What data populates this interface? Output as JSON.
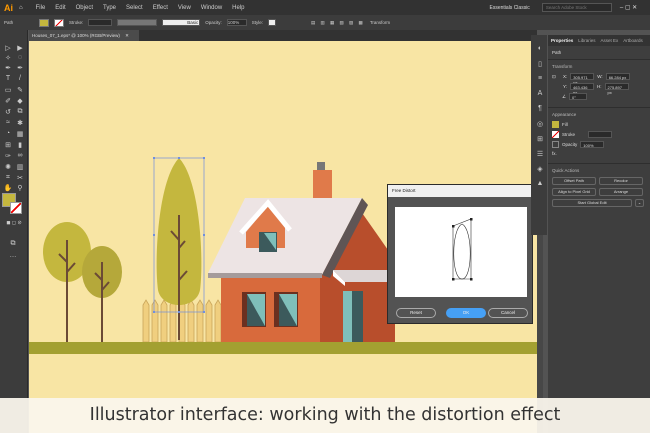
{
  "app": {
    "logo": "Ai",
    "menu": [
      "File",
      "Edit",
      "Object",
      "Type",
      "Select",
      "Effect",
      "View",
      "Window",
      "Help"
    ],
    "workspace": "Essentials Classic",
    "search_placeholder": "Search Adobe Stock"
  },
  "control_bar": {
    "selection": "Path",
    "stroke_label": "Stroke:",
    "brush": "Basic",
    "opacity_label": "Opacity:",
    "opacity": "100%",
    "style_label": "Style:",
    "transform": "Transform",
    "fill_color": "#c4b73e"
  },
  "document": {
    "tab": "Houses_07_1.eps* @ 100% (RGB/Preview)"
  },
  "panel": {
    "tabs": [
      "Properties",
      "Libraries",
      "Asset Ex",
      "Artboards"
    ],
    "object": "Path",
    "transform": {
      "title": "Transform",
      "x_label": "X:",
      "x": "305.971 px",
      "y_label": "Y:",
      "y": "463.436 px",
      "w_label": "W:",
      "w": "66.284 px",
      "h_label": "H:",
      "h": "275.897 px",
      "angle": "0°"
    },
    "appearance": {
      "title": "Appearance",
      "fill": "Fill",
      "stroke": "Stroke",
      "opacity_label": "Opacity",
      "opacity": "100%",
      "fx": "fx."
    },
    "quick_actions": {
      "title": "Quick Actions",
      "buttons": [
        "Offset Path",
        "Recolor",
        "Align to Pixel Grid",
        "Arrange"
      ],
      "global_edit": "Start Global Edit"
    }
  },
  "dialog": {
    "title": "Free Distort",
    "reset": "Reset",
    "ok": "OK",
    "cancel": "Cancel",
    "ok_color": "#46a0f5"
  },
  "caption": "Illustrator interface: working with the distortion effect"
}
